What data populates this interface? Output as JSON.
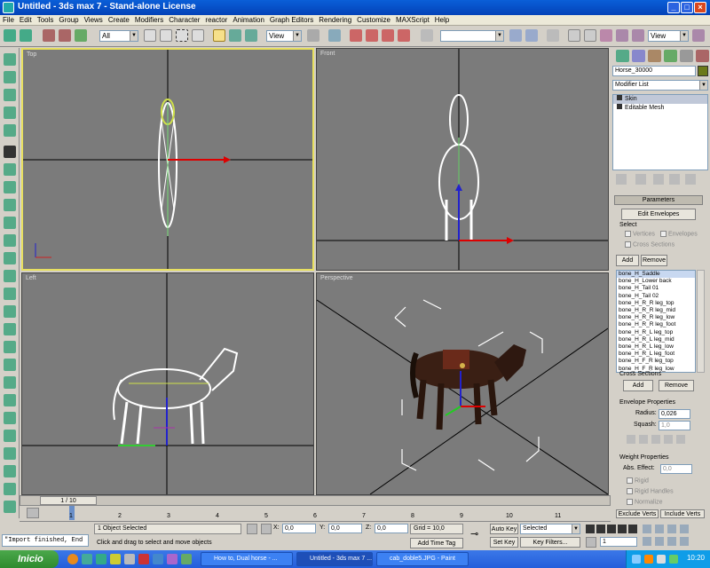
{
  "window": {
    "title": "Untitled - 3ds max 7 - Stand-alone License"
  },
  "menu": [
    "File",
    "Edit",
    "Tools",
    "Group",
    "Views",
    "Create",
    "Modifiers",
    "Character",
    "reactor",
    "Animation",
    "Graph Editors",
    "Rendering",
    "Customize",
    "MAXScript",
    "Help"
  ],
  "toolbar": {
    "selection_filter": "All",
    "ref_coord": "View",
    "named_selection": "",
    "view_dropdown_right": "View"
  },
  "viewports": {
    "top": "Top",
    "front": "Front",
    "left": "Left",
    "perspective": "Perspective"
  },
  "command_panel": {
    "object_name": "Horse_30000",
    "object_color": "#6b7a1a",
    "modifier_list": "Modifier List",
    "stack": [
      "Skin",
      "Editable Mesh"
    ],
    "parameters_title": "Parameters",
    "edit_envelopes": "Edit Envelopes",
    "select_label": "Select",
    "vertices": "Vertices",
    "envelopes": "Envelopes",
    "cross_sections": "Cross Sections",
    "add": "Add",
    "remove": "Remove",
    "bones": [
      "bone_H_Saddle",
      "bone_H_Lower back",
      "bone_H_Tail 01",
      "bone_H_Tail 02",
      "bone_H_R_R leg_top",
      "bone_H_R_R leg_mid",
      "bone_H_R_R leg_low",
      "bone_H_R_R leg_foot",
      "bone_H_R_L leg_top",
      "bone_H_R_L leg_mid",
      "bone_H_R_L leg_low",
      "bone_H_R_L leg_foot",
      "bone_H_F_R leg_top",
      "bone_H_F_R leg_low"
    ],
    "cross_sections_group": "Cross Sections",
    "cs_add": "Add",
    "cs_remove": "Remove",
    "envelope_properties": "Envelope Properties",
    "radius_label": "Radius:",
    "radius_value": "0,026",
    "squash_label": "Squash:",
    "squash_value": "1,0",
    "weight_properties": "Weight Properties",
    "abs_effect_label": "Abs. Effect:",
    "abs_effect_value": "0,0",
    "rigid": "Rigid",
    "rigid_handles": "Rigid Handles",
    "normalize": "Normalize",
    "exclude_verts": "Exclude Verts",
    "include_verts": "Include Verts"
  },
  "timeline": {
    "frame_readout": "1 / 10",
    "ticks": [
      "1",
      "2",
      "3",
      "4",
      "5",
      "6",
      "7",
      "8",
      "9",
      "10",
      "11"
    ]
  },
  "status": {
    "maxscript_line": "\"Import finished, End",
    "selection": "1 Object Selected",
    "prompt": "Click and drag to select and move objects",
    "x_label": "X:",
    "x_value": "0,0",
    "y_label": "Y:",
    "y_value": "0,0",
    "z_label": "Z:",
    "z_value": "0,0",
    "grid": "Grid = 10,0",
    "add_time_tag": "Add Time Tag",
    "auto_key": "Auto Key",
    "set_key": "Set Key",
    "selected_dropdown": "Selected",
    "key_filters": "Key Filters...",
    "current_frame": "1"
  },
  "taskbar": {
    "start": "Inicio",
    "tasks": [
      "How to, Dual horse - ...",
      "Untitled - 3ds max 7 ...",
      "cab_doble5.JPG - Paint"
    ],
    "clock": "10:20"
  }
}
